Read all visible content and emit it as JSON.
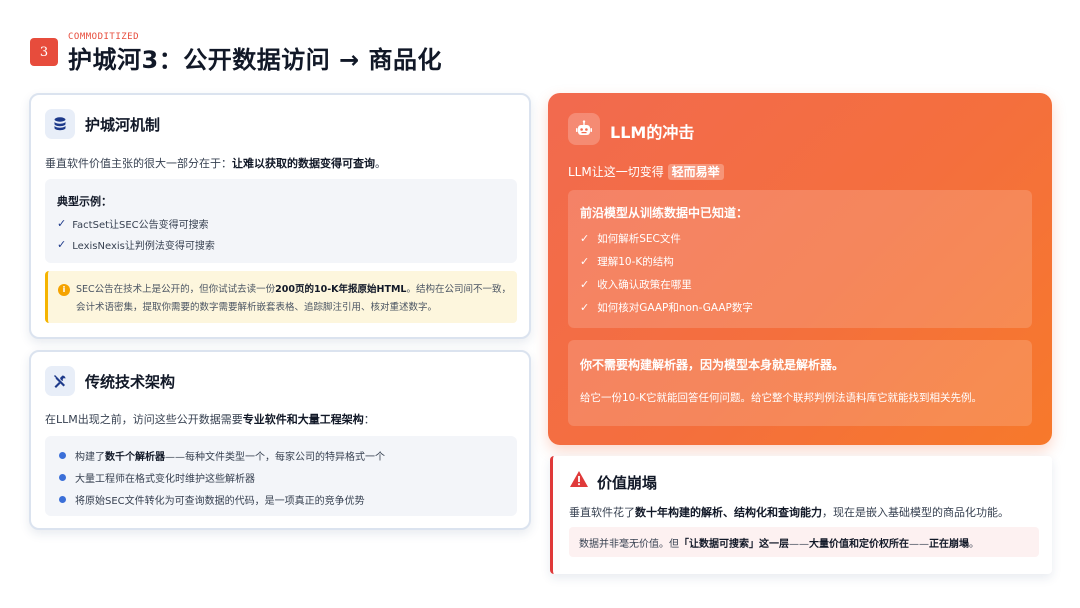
{
  "header": {
    "number": "3",
    "eyebrow": "COMMODITIZED",
    "title": "护城河3：公开数据访问 → 商品化"
  },
  "moat": {
    "title": "护城河机制",
    "icon": "database-icon",
    "lead_pre": "垂直软件价值主张的很大一部分在于：",
    "lead_bold": "让难以获取的数据变得可查询",
    "lead_post": "。",
    "examples_title": "典型示例：",
    "examples": [
      "FactSet让SEC公告变得可搜索",
      "LexisNexis让判例法变得可搜索"
    ],
    "note_pre": "SEC公告在技术上是公开的，但你试试去读一份",
    "note_bold": "200页的10-K年报原始HTML",
    "note_post": "。结构在公司间不一致，",
    "note_line2": "会计术语密集，提取你需要的数字需要解析嵌套表格、追踪脚注引用、核对重述数字。"
  },
  "legacy": {
    "title": "传统技术架构",
    "icon": "wrench-icon",
    "lead_pre": "在LLM出现之前，访问这些公开数据需要",
    "lead_bold": "专业软件和大量工程架构",
    "lead_post": "：",
    "bullets": [
      {
        "pre": "构建了",
        "bold": "数千个解析器",
        "post": "——每种文件类型一个，每家公司的特异格式一个"
      },
      {
        "pre": "大量工程师在格式变化时维护这些解析器",
        "bold": "",
        "post": ""
      },
      {
        "pre": "将原始SEC文件转化为可查询数据的代码，是一项真正的竞争优势",
        "bold": "",
        "post": ""
      }
    ]
  },
  "llm": {
    "title": "LLM的冲击",
    "icon": "robot-icon",
    "lead_pre": "LLM让这一切变得",
    "lead_highlight": "轻而易举",
    "known_title": "前沿模型从训练数据中已知道：",
    "known_items": [
      "如何解析SEC文件",
      "理解10-K的结构",
      "收入确认政策在哪里",
      "如何核对GAAP和non-GAAP数字"
    ],
    "parser_bold": "你不需要构建解析器，因为模型本身就是解析器。",
    "parser_sub": "给它一份10-K它就能回答任何问题。给它整个联邦判例法语料库它就能找到相关先例。"
  },
  "collapse": {
    "title": "价值崩塌",
    "icon": "warning-icon",
    "lead_pre": "垂直软件花了",
    "lead_bold": "数十年构建的解析、结构化和查询能力",
    "lead_post": "，现在是嵌入基础模型的商品化功能。",
    "quote_pre": "数据并非毫无价值。但",
    "quote_bold1": "「让数据可搜索」这一层",
    "quote_mid": "——",
    "quote_bold2": "大量价值和定价权所在",
    "quote_mid2": "——",
    "quote_bold3": "正在崩塌",
    "quote_post": "。"
  },
  "colors": {
    "accent_red": "#e74c3c",
    "orange_start": "#f26a4f",
    "orange_end": "#f7792b",
    "navy": "#1e3a8a",
    "warning_yellow": "#f5b400"
  }
}
